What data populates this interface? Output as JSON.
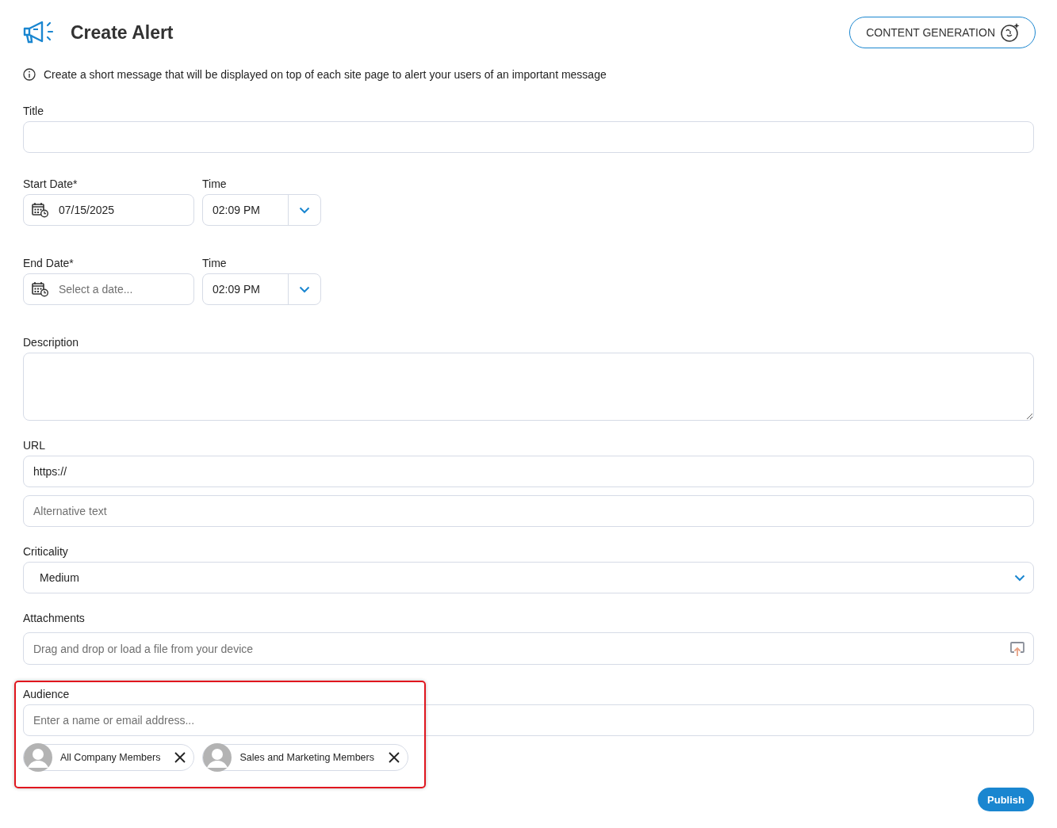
{
  "header": {
    "title": "Create Alert",
    "content_button": "CONTENT GENERATION"
  },
  "info": "Create a short message that will be displayed on top of each site page to alert your users of an important message",
  "title_field": {
    "label": "Title"
  },
  "start": {
    "date_label": "Start Date*",
    "date_value": "07/15/2025",
    "time_label": "Time",
    "time_value": "02:09 PM"
  },
  "end": {
    "date_label": "End Date*",
    "date_placeholder": "Select a date...",
    "time_label": "Time",
    "time_value": "02:09 PM"
  },
  "description": {
    "label": "Description"
  },
  "url": {
    "label": "URL",
    "value": "https://",
    "alt_placeholder": "Alternative text"
  },
  "criticality": {
    "label": "Criticality",
    "value": "Medium"
  },
  "attachments": {
    "label": "Attachments",
    "placeholder": "Drag and drop or load a file from your device"
  },
  "audience": {
    "label": "Audience",
    "placeholder": "Enter a name or email address...",
    "highlighted": true,
    "members": [
      {
        "name": "All Company Members"
      },
      {
        "name": "Sales and Marketing Members"
      }
    ]
  },
  "publish_button": "Publish"
}
